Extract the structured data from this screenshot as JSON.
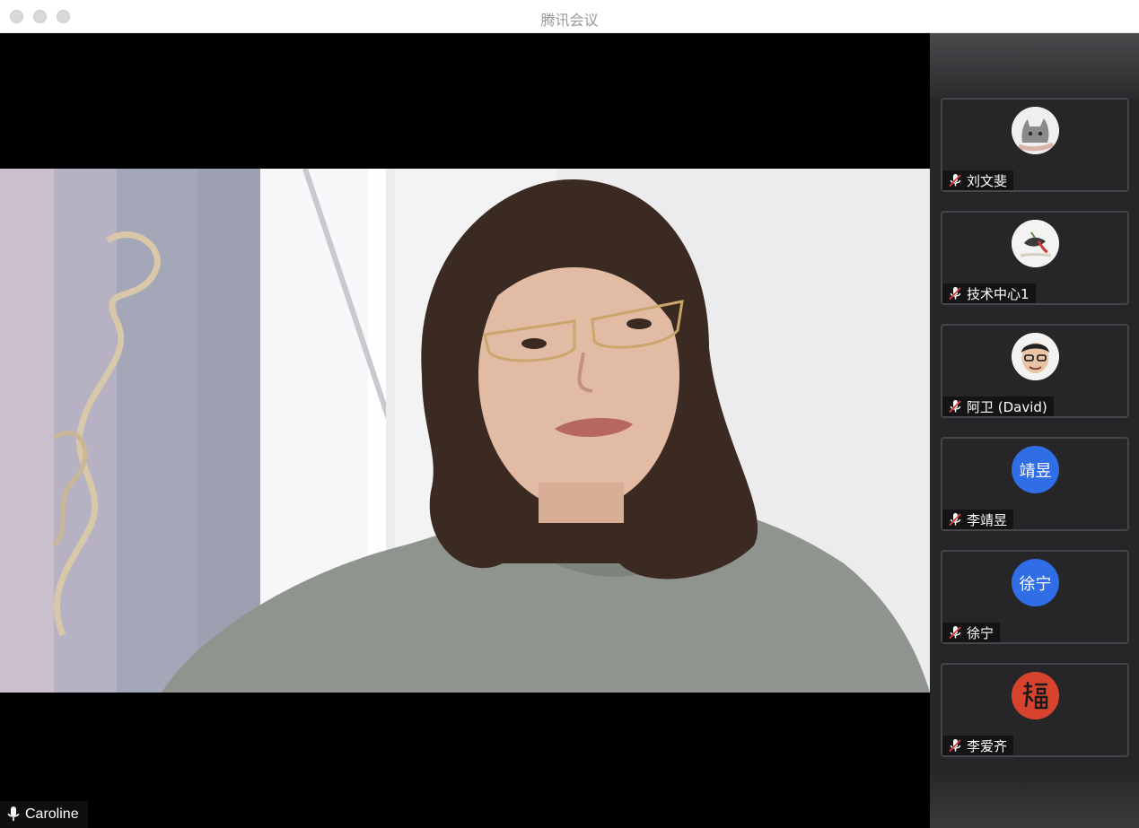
{
  "window": {
    "title": "腾讯会议"
  },
  "main_video": {
    "speaker_name": "Caroline",
    "mic_state": "on"
  },
  "participants": [
    {
      "name": "刘文斐",
      "avatar_text": "",
      "avatar_kind": "cat-photo",
      "mic_state": "muted"
    },
    {
      "name": "技术中心1",
      "avatar_text": "",
      "avatar_kind": "bird-photo",
      "mic_state": "muted"
    },
    {
      "name": "阿卫 (David)",
      "avatar_text": "",
      "avatar_kind": "cartoon-face",
      "mic_state": "muted"
    },
    {
      "name": "李靖昱",
      "avatar_text": "靖昱",
      "avatar_kind": "initials",
      "avatar_color": "#2f6ee6",
      "mic_state": "muted"
    },
    {
      "name": "徐宁",
      "avatar_text": "徐宁",
      "avatar_kind": "initials",
      "avatar_color": "#2f6ee6",
      "mic_state": "muted"
    },
    {
      "name": "李爱齐",
      "avatar_text": "",
      "avatar_kind": "fu-calligraphy",
      "avatar_color": "#d8432e",
      "mic_state": "muted"
    }
  ],
  "colors": {
    "accent_blue": "#2f6ee6",
    "avatar_red": "#d8432e",
    "sidebar_bg": "#262628",
    "tile_border": "#46464a"
  }
}
